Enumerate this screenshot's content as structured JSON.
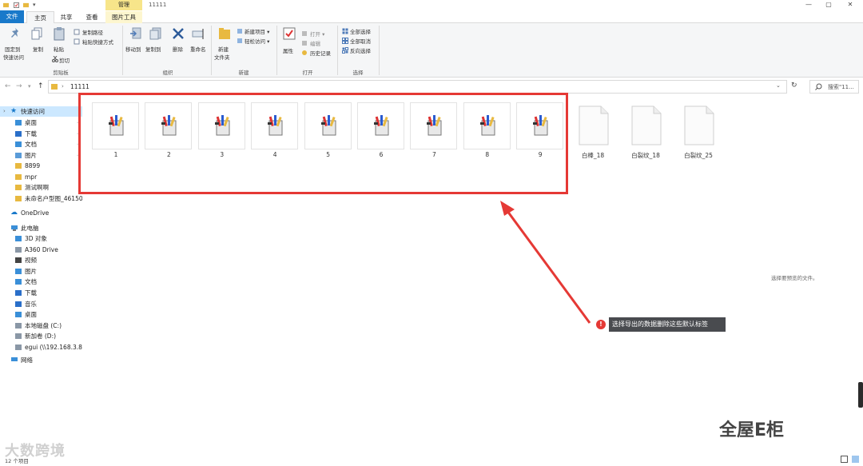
{
  "window": {
    "title": "11111",
    "contextual_tab": "管理",
    "minimize": "—",
    "maximize": "▢",
    "close": "✕"
  },
  "tabs": {
    "file": "文件",
    "home": "主页",
    "share": "共享",
    "view": "查看",
    "picture_tools": "图片工具"
  },
  "ribbon": {
    "pin_quick_access": "固定到\n快速访问",
    "pin_line1": "固定到",
    "pin_line2": "快速访问",
    "copy": "复制",
    "paste": "粘贴",
    "copy_path": "复制路径",
    "paste_shortcut": "粘贴快捷方式",
    "cut": "剪切",
    "group_clipboard": "剪贴板",
    "move_to": "移动到",
    "copy_to": "复制到",
    "delete": "删除",
    "rename": "重命名",
    "group_organize": "组织",
    "new_folder_line1": "新建",
    "new_folder_line2": "文件夹",
    "new_item": "新建项目 ▾",
    "easy_access": "轻松访问 ▾",
    "group_new": "新建",
    "properties": "属性",
    "open": "打开 ▾",
    "edit": "编辑",
    "history": "历史记录",
    "group_open": "打开",
    "select_all": "全部选择",
    "select_none": "全部取消",
    "invert_selection": "反向选择",
    "group_select": "选择"
  },
  "address": {
    "path": "11111",
    "search_placeholder": "搜索\"11..."
  },
  "nav": {
    "quick_access": "快速访问",
    "quick_items": [
      "桌面",
      "下载",
      "文档",
      "图片",
      "8899",
      "mpr",
      "测试啊啊",
      "未命名户型图_46150"
    ],
    "onedrive": "OneDrive",
    "this_pc": "此电脑",
    "pc_items": [
      "3D 对象",
      "A360 Drive",
      "视频",
      "图片",
      "文档",
      "下载",
      "音乐",
      "桌面",
      "本地磁盘 (C:)",
      "新加卷 (D:)",
      "egui (\\\\192.168.3.88"
    ],
    "network": "网络"
  },
  "files": {
    "images": [
      "1",
      "2",
      "3",
      "4",
      "5",
      "6",
      "7",
      "8",
      "9"
    ],
    "docs": [
      "白棒_18",
      "白裂纹_18",
      "白裂纹_25"
    ]
  },
  "annotation": {
    "badge": "!",
    "tooltip": "选择导出的数据删除这些默认标签"
  },
  "preview_message": "选择要预览的文件。",
  "status": {
    "item_count": "12 个项目"
  },
  "watermarks": {
    "left": "大数跨境",
    "right": "全屋E柜"
  },
  "colors": {
    "accent": "#1979ca",
    "highlight": "#e53935",
    "manage_tab": "#f7e58a"
  }
}
